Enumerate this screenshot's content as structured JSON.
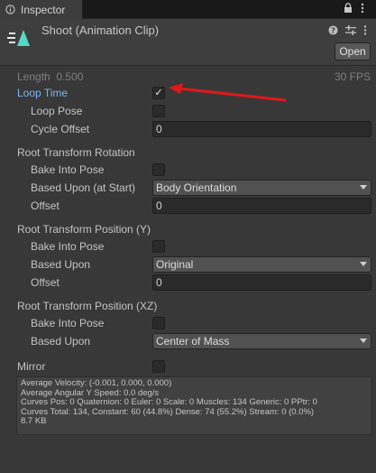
{
  "tab": {
    "label": "Inspector"
  },
  "header": {
    "title": "Shoot (Animation Clip)",
    "open_label": "Open"
  },
  "info": {
    "length_label": "Length",
    "length_value": "0.500",
    "fps": "30 FPS"
  },
  "loop_time": {
    "label": "Loop Time",
    "checked": true
  },
  "loop_pose": {
    "label": "Loop Pose"
  },
  "cycle_offset": {
    "label": "Cycle Offset",
    "value": "0"
  },
  "root_rotation": {
    "title": "Root Transform Rotation",
    "bake_label": "Bake Into Pose",
    "based_label": "Based Upon (at Start)",
    "based_value": "Body Orientation",
    "offset_label": "Offset",
    "offset_value": "0"
  },
  "root_position_y": {
    "title": "Root Transform Position (Y)",
    "bake_label": "Bake Into Pose",
    "based_label": "Based Upon",
    "based_value": "Original",
    "offset_label": "Offset",
    "offset_value": "0"
  },
  "root_position_xz": {
    "title": "Root Transform Position (XZ)",
    "bake_label": "Bake Into Pose",
    "based_label": "Based Upon",
    "based_value": "Center of Mass"
  },
  "mirror": {
    "label": "Mirror"
  },
  "stats": {
    "lines": [
      "Average Velocity: (-0.001, 0.000, 0.000)",
      "Average Angular Y Speed: 0.0 deg/s",
      "Curves Pos: 0 Quaternion: 0 Euler: 0 Scale: 0 Muscles: 134 Generic: 0 PPtr: 0",
      "Curves Total: 134, Constant: 60 (44.8%) Dense: 74 (55.2%) Stream: 0 (0.0%)",
      "8.7 KB"
    ]
  },
  "colors": {
    "background": "#383838",
    "accent_label": "#7ab5f0",
    "arrow": "#e01818"
  },
  "icons": [
    "info-icon",
    "lock-icon",
    "menu-icon",
    "animation-clip-icon",
    "help-icon",
    "settings-sliders-icon",
    "more-icon",
    "checkmark-icon",
    "dropdown-caret-icon",
    "red-arrow-annotation"
  ]
}
